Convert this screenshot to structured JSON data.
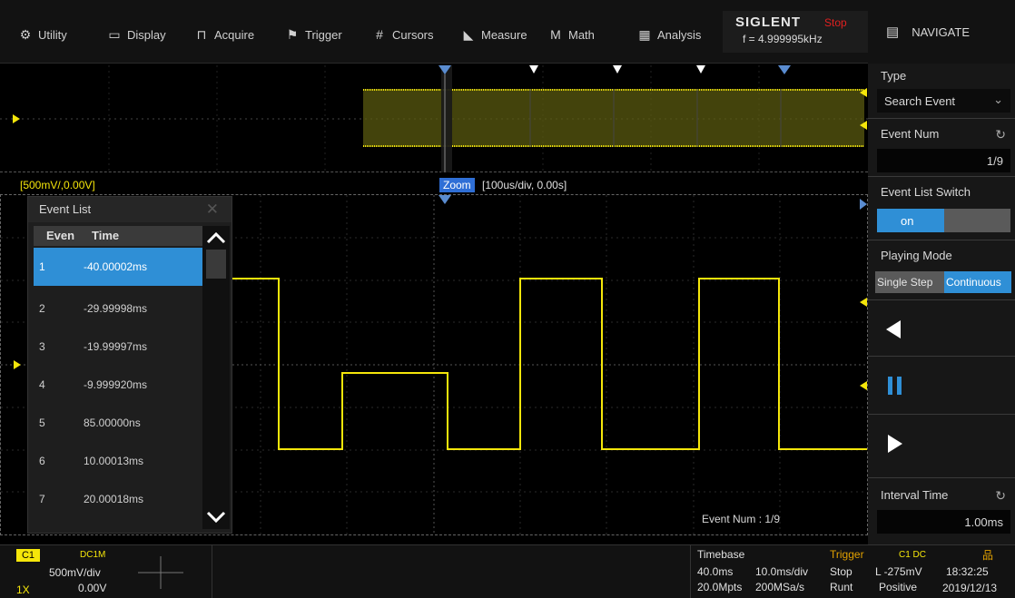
{
  "menu": [
    {
      "label": "Utility",
      "icon": "⚙"
    },
    {
      "label": "Display",
      "icon": "▭"
    },
    {
      "label": "Acquire",
      "icon": "⊓"
    },
    {
      "label": "Trigger",
      "icon": "⚑"
    },
    {
      "label": "Cursors",
      "icon": "#"
    },
    {
      "label": "Measure",
      "icon": "◣"
    },
    {
      "label": "Math",
      "icon": "M"
    },
    {
      "label": "Analysis",
      "icon": "▦"
    }
  ],
  "brand": {
    "logo": "SIGLENT",
    "status": "Stop",
    "frequency": "f = 4.999995kHz"
  },
  "panel": {
    "title": "NAVIGATE",
    "type_label": "Type",
    "type_value": "Search Event",
    "event_num_label": "Event Num",
    "event_num_value": "1/9",
    "event_list_switch_label": "Event List Switch",
    "event_list_switch_value": "on",
    "playing_mode_label": "Playing Mode",
    "playing_mode_options": [
      "Single Step",
      "Continuous"
    ],
    "interval_time_label": "Interval Time",
    "interval_time_value": "1.00ms"
  },
  "scope": {
    "channel_scale": "[500mV/,0.00V]",
    "zoom_label": "Zoom",
    "zoom_value": "[100us/div, 0.00s]",
    "event_num_overlay": "Event Num : 1/9",
    "channel_marker": "C1"
  },
  "event_list": {
    "title": "Event List",
    "col_event": "Even",
    "col_time": "Time",
    "rows": [
      {
        "num": "1",
        "time": "-40.00002ms"
      },
      {
        "num": "2",
        "time": "-29.99998ms"
      },
      {
        "num": "3",
        "time": "-19.99997ms"
      },
      {
        "num": "4",
        "time": "-9.999920ms"
      },
      {
        "num": "5",
        "time": "85.00000ns"
      },
      {
        "num": "6",
        "time": "10.00013ms"
      },
      {
        "num": "7",
        "time": "20.00018ms"
      }
    ]
  },
  "channel": {
    "name": "C1",
    "coupling": "DC1M",
    "scale": "500mV/div",
    "offset": "0.00V",
    "probe": "1X"
  },
  "timebase": {
    "label": "Timebase",
    "delay": "40.0ms",
    "scale": "10.0ms/div",
    "memory": "20.0Mpts",
    "sample_rate": "200MSa/s"
  },
  "trigger": {
    "label": "Trigger",
    "state": "Stop",
    "mode": "Runt",
    "source": "C1 DC",
    "level": "L -275mV",
    "polarity": "Positive"
  },
  "clock": {
    "time": "18:32:25",
    "date": "2019/12/13"
  },
  "colors": {
    "trace": "#f5e60a",
    "accent": "#2f8fd6",
    "stop": "#e02020",
    "trigger": "#e0a000"
  }
}
